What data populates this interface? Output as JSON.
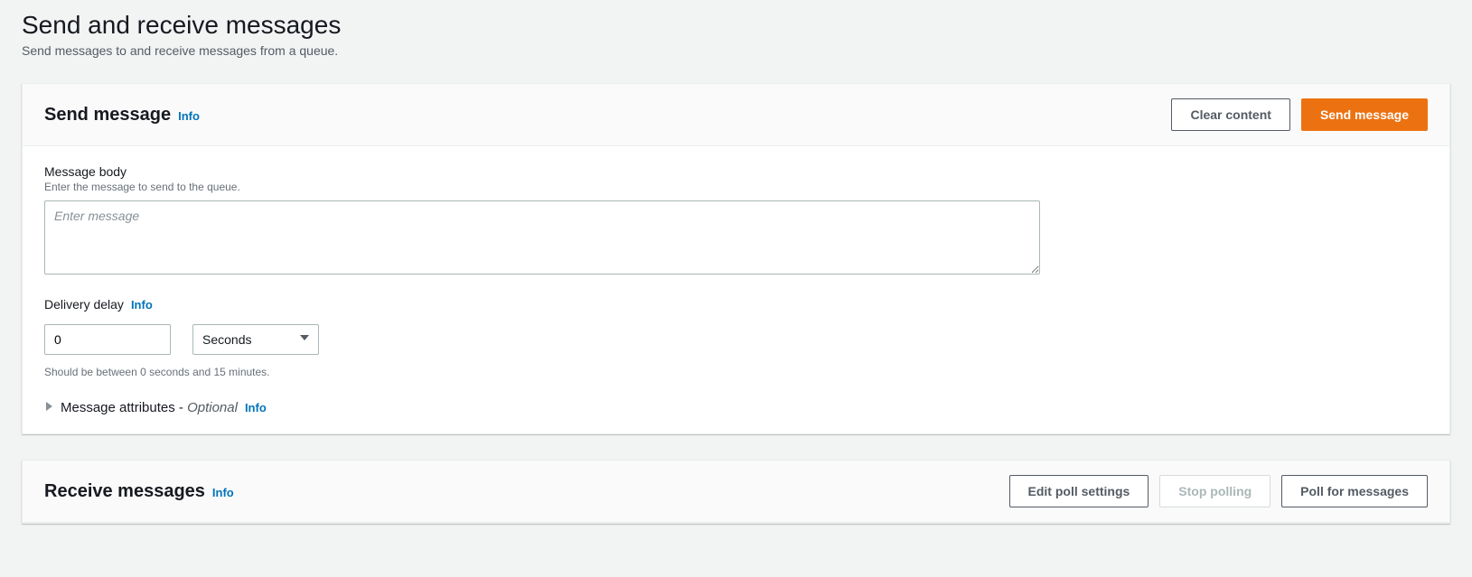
{
  "page": {
    "title": "Send and receive messages",
    "subtitle": "Send messages to and receive messages from a queue."
  },
  "info_label": "Info",
  "send": {
    "panel_title": "Send message",
    "clear_btn": "Clear content",
    "send_btn": "Send message",
    "body_label": "Message body",
    "body_desc": "Enter the message to send to the queue.",
    "body_placeholder": "Enter message",
    "delay_label": "Delivery delay",
    "delay_value": "0",
    "delay_unit": "Seconds",
    "delay_hint": "Should be between 0 seconds and 15 minutes.",
    "attributes_label": "Message attributes - ",
    "attributes_optional": "Optional"
  },
  "receive": {
    "panel_title": "Receive messages",
    "edit_btn": "Edit poll settings",
    "stop_btn": "Stop polling",
    "poll_btn": "Poll for messages"
  }
}
